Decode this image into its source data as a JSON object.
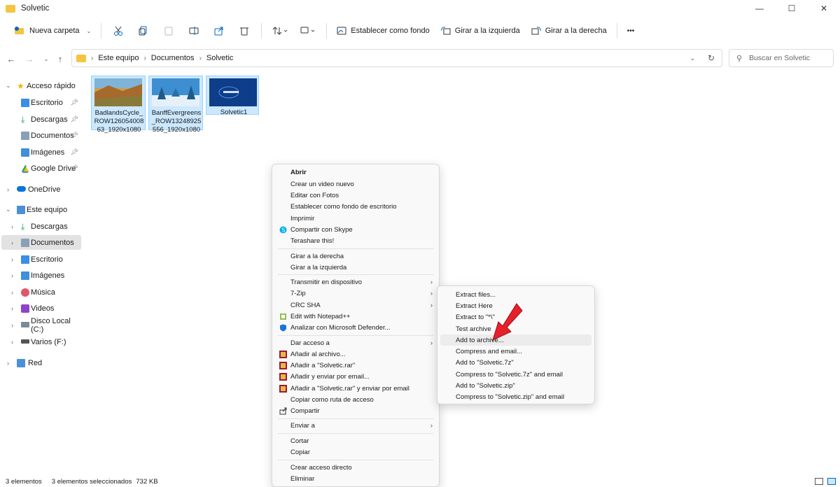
{
  "window": {
    "title": "Solvetic",
    "minimize": "—",
    "maximize": "☐",
    "close": "✕"
  },
  "toolbar": {
    "new_folder": "Nueva carpeta",
    "set_background": "Establecer como fondo",
    "rotate_left": "Girar a la izquierda",
    "rotate_right": "Girar a la derecha",
    "more": "•••"
  },
  "address": {
    "crumbs": [
      "Este equipo",
      "Documentos",
      "Solvetic"
    ],
    "search_placeholder": "Buscar en Solvetic"
  },
  "sidebar": {
    "quick_access": "Acceso rápido",
    "qa_items": [
      "Escritorio",
      "Descargas",
      "Documentos",
      "Imágenes",
      "Google Drive"
    ],
    "onedrive": "OneDrive",
    "this_pc": "Este equipo",
    "pc_items": [
      "Descargas",
      "Documentos",
      "Escritorio",
      "Imágenes",
      "Música",
      "Videos",
      "Disco Local (C:)",
      "Varios (F:)"
    ],
    "network": "Red"
  },
  "files": [
    {
      "name": "BadlandsCycle_ROW12605400863_1920x1080"
    },
    {
      "name": "BanffEvergreens_ROW13248925556_1920x1080"
    },
    {
      "name": "Solvetic1"
    }
  ],
  "context_menu": {
    "items": [
      "Abrir",
      "Crear un video nuevo",
      "Editar con Fotos",
      "Establecer como fondo de escritorio",
      "Imprimir",
      "Compartir con Skype",
      "Terashare this!",
      "Girar a la derecha",
      "Girar a la izquierda",
      "Transmitir en dispositivo",
      "7-Zip",
      "CRC SHA",
      "Edit with Notepad++",
      "Analizar con Microsoft Defender...",
      "Dar acceso a",
      "Añadir al archivo...",
      "Añadir a \"Solvetic.rar\"",
      "Añadir y enviar por email...",
      "Añadir a \"Solvetic.rar\" y enviar por email",
      "Copiar como ruta de acceso",
      "Compartir",
      "Enviar a",
      "Cortar",
      "Copiar",
      "Crear acceso directo",
      "Eliminar"
    ]
  },
  "submenu": {
    "items": [
      "Extract files...",
      "Extract Here",
      "Extract to \"*\\\"",
      "Test archive",
      "Add to archive...",
      "Compress and email...",
      "Add to \"Solvetic.7z\"",
      "Compress to \"Solvetic.7z\" and email",
      "Add to \"Solvetic.zip\"",
      "Compress to \"Solvetic.zip\" and email"
    ]
  },
  "status": {
    "count": "3 elementos",
    "selected": "3 elementos seleccionados",
    "size": "732 KB"
  },
  "colors": {
    "selection": "#cce8ff",
    "accent": "#0067c0",
    "arrow": "#e8202a"
  }
}
